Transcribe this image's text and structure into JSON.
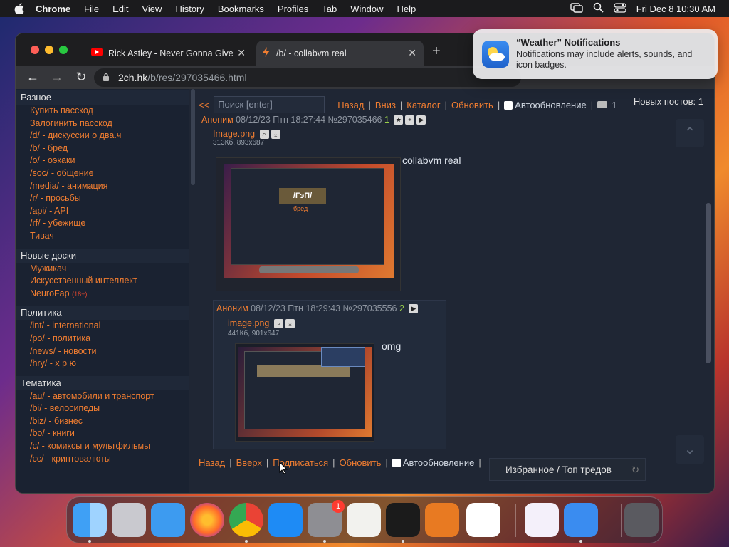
{
  "menubar": {
    "app": "Chrome",
    "items": [
      "File",
      "Edit",
      "View",
      "History",
      "Bookmarks",
      "Profiles",
      "Tab",
      "Window",
      "Help"
    ],
    "datetime": "Fri Dec 8  10:30 AM"
  },
  "tabs": [
    {
      "title": "Rick Astley - Never Gonna Give You Up",
      "icon": "youtube-icon"
    },
    {
      "title": "/b/ - collabvm real",
      "icon": "bolt-icon"
    }
  ],
  "address": {
    "host": "2ch.hk",
    "path": "/b/res/297035466.html"
  },
  "notification": {
    "title": "“Weather” Notifications",
    "body": "Notifications may include alerts, sounds, and icon badges."
  },
  "sidebar": [
    {
      "title": "Разное",
      "items": [
        "Купить пасскод",
        "Залогинить пасскод",
        "/d/ - дискуссии о два.ч",
        "/b/ - бред",
        "/o/ - оэкаки",
        "/soc/ - общение",
        "/media/ - анимация",
        "/r/ - просьбы",
        "/api/ - API",
        "/rf/ - убежище",
        "Тивач"
      ]
    },
    {
      "title": "Новые доски",
      "items": [
        "Мужикач",
        "Искусственный интеллект",
        "NeuroFap"
      ],
      "badge": "(18+)"
    },
    {
      "title": "Политика",
      "items": [
        "/int/ - international",
        "/po/ - политика",
        "/news/ - новости",
        "/hry/ - х р ю"
      ]
    },
    {
      "title": "Тематика",
      "items": [
        "/au/ - автомобили и транспорт",
        "/bi/ - велосипеды",
        "/biz/ - бизнес",
        "/bo/ - книги",
        "/c/ - комиксы и мультфильмы",
        "/cc/ - криптовалюты"
      ]
    }
  ],
  "topbar": {
    "back_arrow": "<<",
    "search_placeholder": "Поиск [enter]",
    "back": "Назад",
    "down": "Вниз",
    "catalog": "Каталог",
    "refresh": "Обновить",
    "autorefresh": "Автообновление",
    "online": "1",
    "new_posts": "Новых постов: 1"
  },
  "op": {
    "name": "Аноним",
    "date": "08/12/23 Птн 18:27:44",
    "num": "№297035466",
    "idx": "1",
    "file": "Image.png",
    "meta": "313Кб, 893x687",
    "text": "collabvm real",
    "thumb_title": "/ГэП/",
    "thumb_sub": "бред"
  },
  "reply": {
    "name": "Аноним",
    "date": "08/12/23 Птн 18:29:43",
    "num": "№297035556",
    "idx": "2",
    "file": "image.png",
    "meta": "441Кб, 901x647",
    "text": "omg"
  },
  "bottombar": {
    "back": "Назад",
    "up": "Вверх",
    "subscribe": "Подписаться",
    "refresh": "Обновить",
    "autorefresh": "Автообновление"
  },
  "favorites": "Избранное / Топ тредов",
  "colors": {
    "accent": "#f07d31",
    "bg": "#1f2634",
    "sidebar": "#1a2231"
  },
  "dock": [
    "finder",
    "launchpad",
    "safari",
    "firefox",
    "chrome",
    "app-store",
    "system-settings",
    "textedit",
    "terminal",
    "garageband",
    "vscode",
    "visual-studio",
    "weather",
    "trash"
  ],
  "dock_badge": "1"
}
